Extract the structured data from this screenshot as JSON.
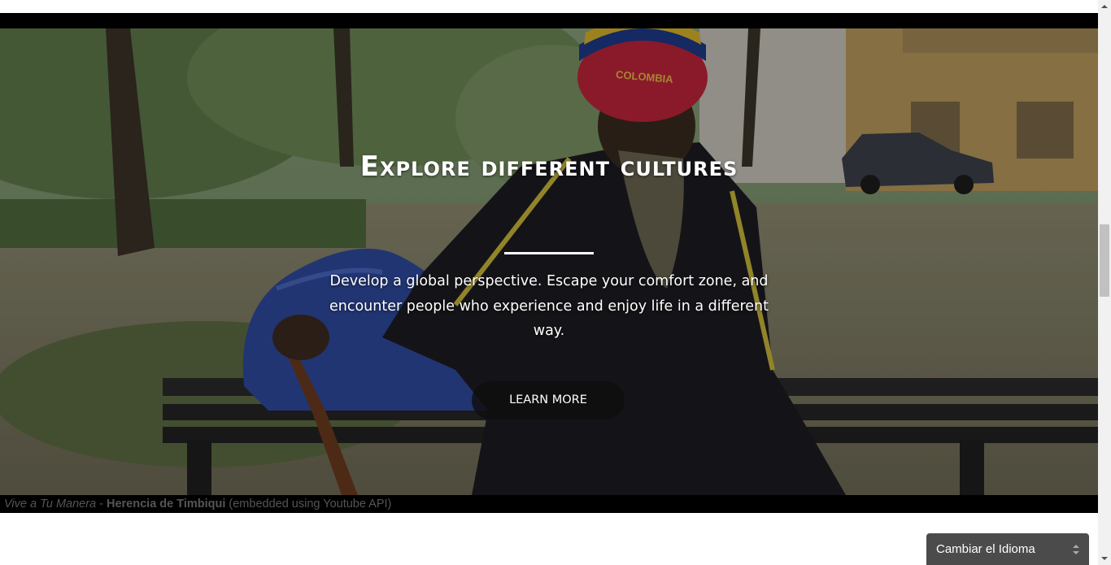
{
  "hero": {
    "title": "Explore different cultures",
    "subtitle": "Develop a global perspective. Escape your comfort zone, and encounter people who experience and enjoy life in a different way.",
    "button_label": "LEARN MORE",
    "hat_text": "COLOMBIA"
  },
  "caption": {
    "series": "Vive a Tu Manera",
    "separator": " - ",
    "video_title": "Herencia de Timbiqui",
    "note": " (embedded using Youtube API)"
  },
  "language_selector": {
    "label": "Cambiar el Idioma"
  },
  "icons": {
    "scroll_up": "chevron-up-icon",
    "scroll_down": "chevron-down-icon",
    "select_arrows": "select-arrows-icon"
  }
}
